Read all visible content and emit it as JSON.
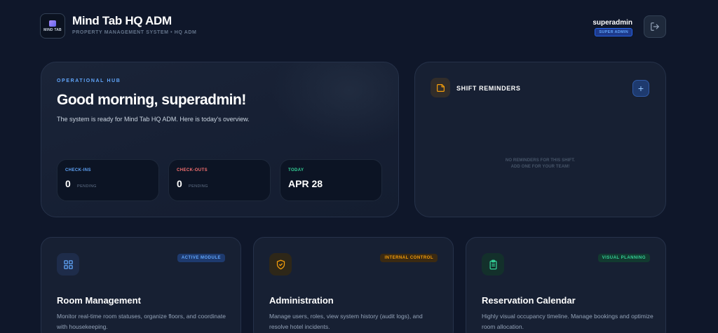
{
  "header": {
    "logo_text": "MIND TAB",
    "app_title": "Mind Tab HQ ADM",
    "app_subtitle": "PROPERTY MANAGEMENT SYSTEM • HQ ADM",
    "user_name": "superadmin",
    "user_role": "SUPER ADMIN",
    "logout_icon": "logout-icon"
  },
  "hub": {
    "eyebrow": "OPERATIONAL HUB",
    "greeting": "Good morning, superadmin!",
    "description": "The system is ready for Mind Tab HQ ADM. Here is today's overview.",
    "stats": [
      {
        "label": "CHECK-INS",
        "value": "0",
        "sub": "PENDING",
        "color": "#60a5fa"
      },
      {
        "label": "CHECK-OUTS",
        "value": "0",
        "sub": "PENDING",
        "color": "#f87171"
      },
      {
        "label": "TODAY",
        "value": "APR 28",
        "sub": "",
        "color": "#34d399"
      }
    ]
  },
  "reminders": {
    "icon": "note-icon",
    "title": "SHIFT REMINDERS",
    "add_label": "+",
    "empty_line1": "NO REMINDERS FOR THIS SHIFT.",
    "empty_line2": "ADD ONE FOR YOUR TEAM!"
  },
  "modules": [
    {
      "icon": "grid-icon",
      "badge": "ACTIVE MODULE",
      "title": "Room Management",
      "description": "Monitor real-time room statuses, organize floors, and coordinate with housekeeping.",
      "badge_color": "#60a5fa",
      "badge_bg": "#1e3a6e",
      "icon_bg": "#1e2c4a",
      "icon_color": "#60a5fa"
    },
    {
      "icon": "shield-icon",
      "badge": "INTERNAL CONTROL",
      "title": "Administration",
      "description": "Manage users, roles, view system history (audit logs), and resolve hotel incidents.",
      "badge_color": "#f59e0b",
      "badge_bg": "#3b2a12",
      "icon_bg": "#2e2718",
      "icon_color": "#f59e0b"
    },
    {
      "icon": "clipboard-icon",
      "badge": "VISUAL PLANNING",
      "title": "Reservation Calendar",
      "description": "Highly visual occupancy timeline. Manage bookings and optimize room allocation.",
      "badge_color": "#34d399",
      "badge_bg": "#123a30",
      "icon_bg": "#13302b",
      "icon_color": "#34d399"
    }
  ]
}
